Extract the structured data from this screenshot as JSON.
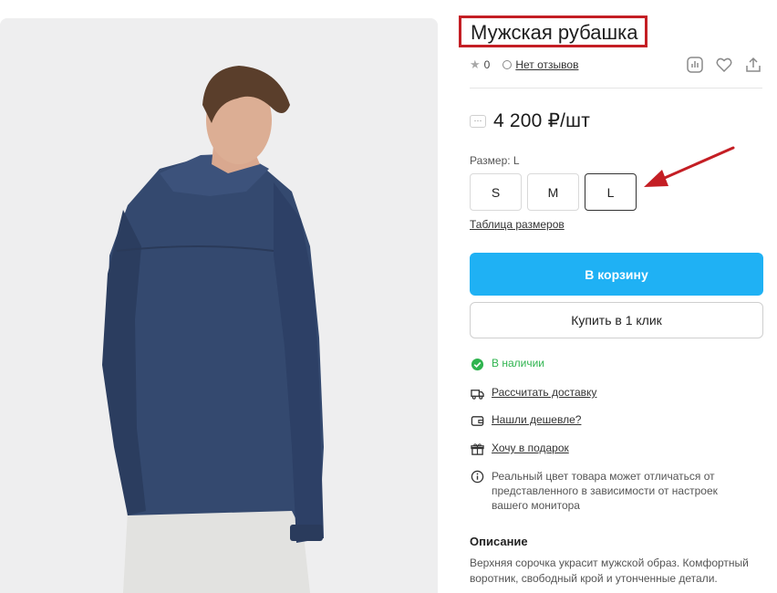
{
  "product": {
    "title": "Мужская рубашка",
    "rating": "0",
    "reviews_label": "Нет отзывов",
    "price_badge": "···",
    "price": "4 200 ₽/шт"
  },
  "actions": [
    "compare-icon",
    "favorite-icon",
    "share-icon"
  ],
  "sizes": {
    "label": "Размер: L",
    "options": [
      "S",
      "M",
      "L"
    ],
    "selected": "L",
    "table_link": "Таблица размеров"
  },
  "buttons": {
    "cart": "В корзину",
    "one_click": "Купить в 1 клик"
  },
  "info": {
    "stock": "В наличии",
    "delivery": "Рассчитать доставку",
    "cheaper": "Нашли дешевле?",
    "gift": "Хочу в подарок",
    "note_line1": "Реальный цвет товара может отличаться от",
    "note_line2": "представленного в зависимости от настроек",
    "note_line3": "вашего монитора"
  },
  "description": {
    "heading": "Описание",
    "line1": "Верхняя сорочка украсит мужской образ. Комфортный",
    "line2": "воротник, свободный крой и утонченные детали."
  },
  "colors": {
    "accent": "#1fb1f4",
    "highlight_box": "#c41e24",
    "arrow": "#c41e24",
    "in_stock": "#2fb44f",
    "shirt": "#34496f"
  }
}
